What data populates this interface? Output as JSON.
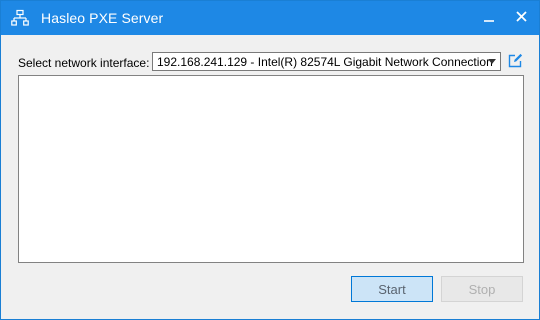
{
  "window": {
    "title": "Hasleo PXE Server",
    "icons": {
      "app": "network-icon",
      "minimize": "minimize-icon",
      "close": "close-icon"
    },
    "accent_color": "#1e88e5"
  },
  "network": {
    "label": "Select network interface:",
    "selected_interface": "192.168.241.129 - Intel(R) 82574L Gigabit Network Connection",
    "edit_icon": "edit-icon"
  },
  "log": {
    "content": ""
  },
  "actions": {
    "start_label": "Start",
    "stop_label": "Stop",
    "stop_enabled": false
  }
}
